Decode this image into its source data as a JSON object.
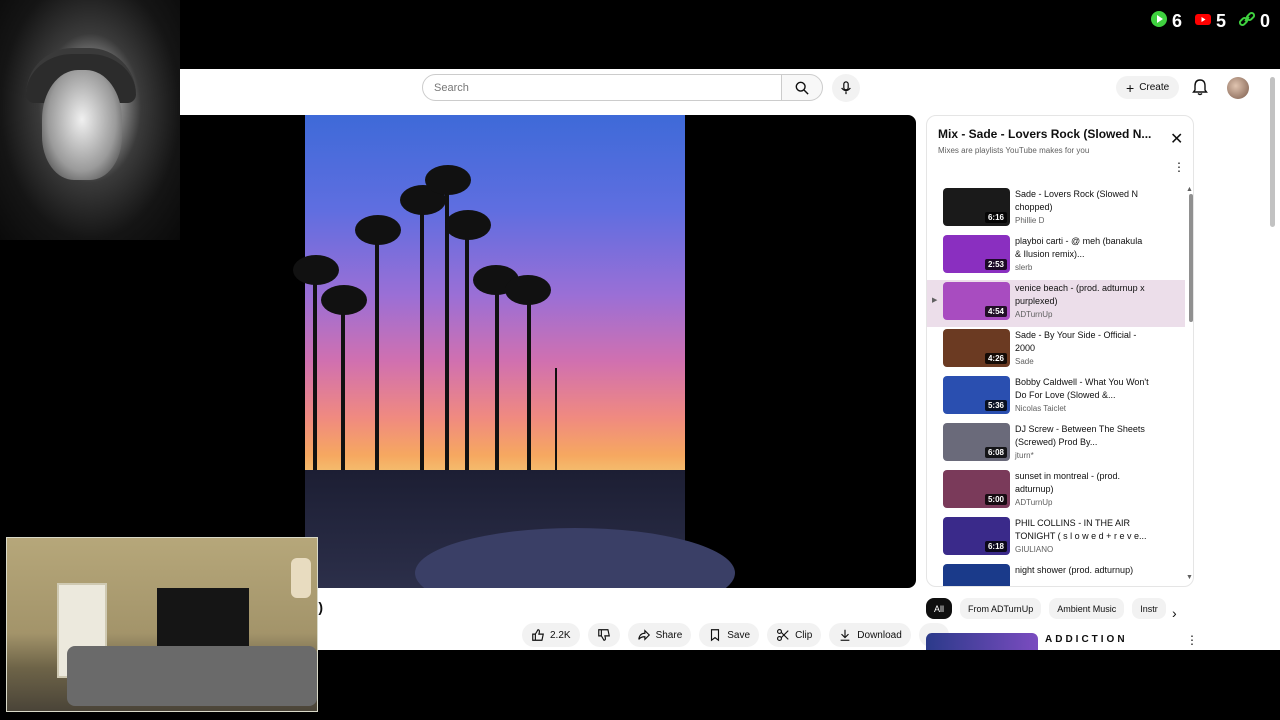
{
  "overlay": {
    "counters": [
      {
        "icon": "play-icon",
        "value": "6",
        "color": "#3fd13f"
      },
      {
        "icon": "youtube-icon",
        "value": "5",
        "color": "#ff0000"
      },
      {
        "icon": "link-icon",
        "value": "0",
        "color": "#3fd13f"
      }
    ]
  },
  "header": {
    "search_placeholder": "Search",
    "create_label": "Create"
  },
  "video": {
    "title_fragment": "ed)",
    "actions": {
      "like_count": "2.2K",
      "share": "Share",
      "save": "Save",
      "clip": "Clip",
      "download": "Download"
    }
  },
  "playlist": {
    "title": "Mix - Sade - Lovers Rock (Slowed N...",
    "subtitle": "Mixes are playlists YouTube makes for you",
    "items": [
      {
        "title": "Sade - Lovers Rock (Slowed N chopped)",
        "channel": "Phillie D",
        "duration": "6:16",
        "thumb": "#1a1a1a"
      },
      {
        "title": "playboi carti - @ meh (banakula & Ilusion remix)...",
        "channel": "slerb",
        "duration": "2:53",
        "thumb": "#8a2fc0"
      },
      {
        "title": "venice beach - (prod. adturnup x purplexed)",
        "channel": "ADTurnUp",
        "duration": "4:54",
        "thumb": "#a84cc0"
      },
      {
        "title": "Sade - By Your Side - Official - 2000",
        "channel": "Sade",
        "duration": "4:26",
        "thumb": "#6b3a22"
      },
      {
        "title": "Bobby Caldwell - What You Won't Do For Love (Slowed &...",
        "channel": "Nicolas Taiclet",
        "duration": "5:36",
        "thumb": "#2a4fb0"
      },
      {
        "title": "DJ Screw - Between The Sheets (Screwed) Prod By...",
        "channel": "jturn*",
        "duration": "6:08",
        "thumb": "#6a6a7a"
      },
      {
        "title": "sunset in montreal - (prod. adturnup)",
        "channel": "ADTurnUp",
        "duration": "5:00",
        "thumb": "#7a3a5a"
      },
      {
        "title": "PHIL COLLINS - IN THE AIR TONIGHT ( s l o w e d + r e v e...",
        "channel": "GIULIANO",
        "duration": "6:18",
        "thumb": "#3a2a8a"
      },
      {
        "title": "night shower (prod. adturnup)",
        "channel": "ADTurnUp",
        "duration": "",
        "thumb": "#1a3a8a"
      }
    ]
  },
  "chips": [
    "All",
    "From ADTurnUp",
    "Ambient Music",
    "Instr"
  ],
  "recommended": {
    "title": "ADDICTION"
  }
}
